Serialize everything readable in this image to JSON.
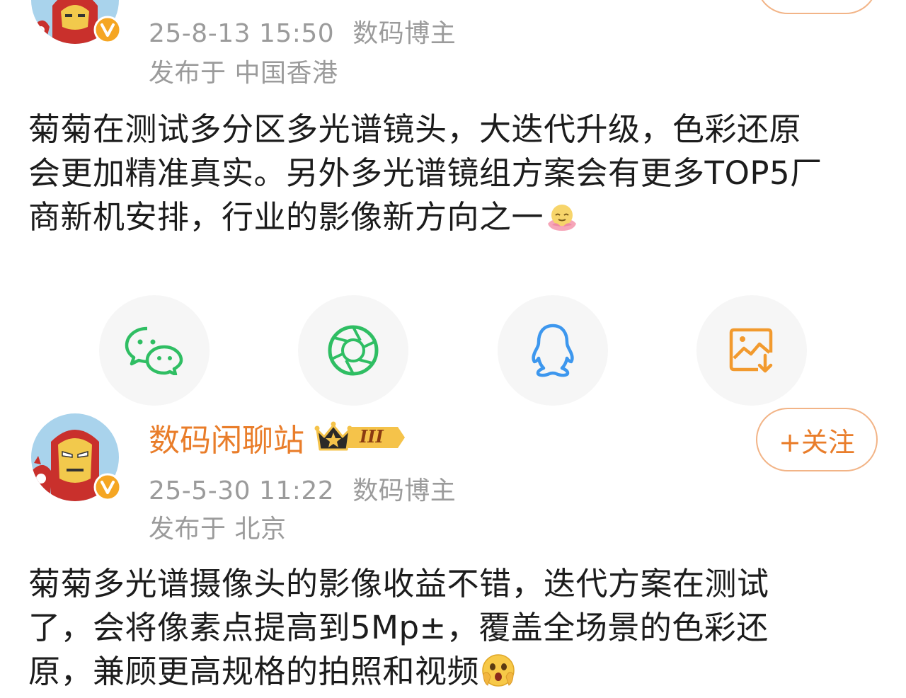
{
  "posts": [
    {
      "date": "25-8-13 15:50",
      "role": "数码博主",
      "location_prefix": "发布于",
      "location": "中国香港",
      "text_lines": [
        "菊菊在测试多分区多光谱镜头，大迭代升级，色彩还原",
        "会更加精准真实。另外多光谱镜组方案会有更多TOP5厂",
        "商新机安排，行业的影像新方向之一"
      ],
      "trailing_emoji": "lotus-smile-emoji"
    },
    {
      "username": "数码闲聊站",
      "vip_level": "III",
      "follow_label": "+关注",
      "date": "25-5-30 11:22",
      "role": "数码博主",
      "location_prefix": "发布于",
      "location": "北京",
      "text_lines": [
        "菊菊多光谱摄像头的影像收益不错，迭代方案在测试",
        "了，会将像素点提高到5Mp±，覆盖全场景的色彩还",
        "原，兼顾更高规格的拍照和视频"
      ],
      "trailing_emoji": "shocked-face-emoji"
    }
  ],
  "share_buttons": [
    {
      "name": "wechat",
      "icon": "wechat-icon",
      "color": "#2fbe63"
    },
    {
      "name": "moments",
      "icon": "moments-icon",
      "color": "#2fbe63"
    },
    {
      "name": "qq",
      "icon": "qq-icon",
      "color": "#3d97ee"
    },
    {
      "name": "save-image",
      "icon": "save-image-icon",
      "color": "#f29a2e"
    }
  ],
  "colors": {
    "username": "#e97d2a",
    "meta_text": "#9b9b9b",
    "verified_badge": "#f5a623",
    "share_bg": "#f6f6f6"
  }
}
